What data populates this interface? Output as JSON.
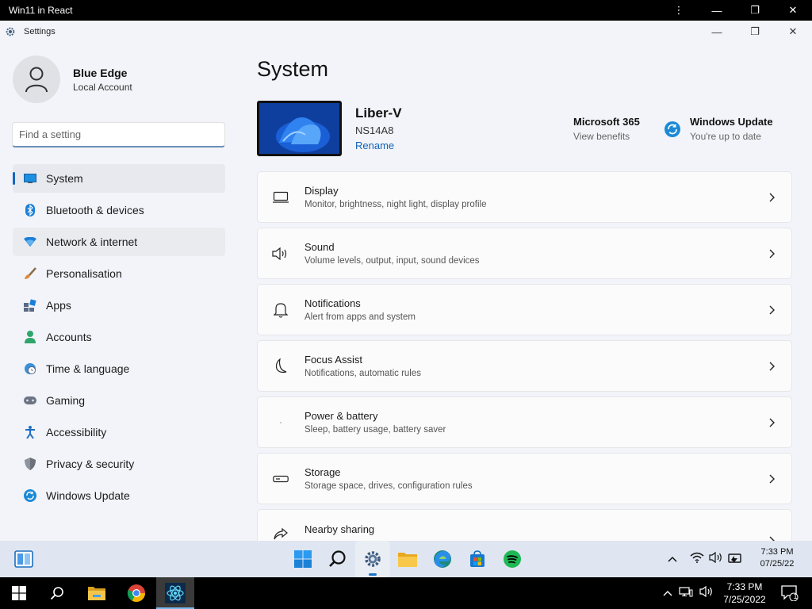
{
  "host": {
    "title": "Win11 in React",
    "controls": [
      "⋮",
      "—",
      "❐",
      "✕"
    ]
  },
  "settings_window": {
    "title": "Settings",
    "controls": [
      "—",
      "❐",
      "✕"
    ]
  },
  "profile": {
    "name": "Blue Edge",
    "account_type": "Local Account"
  },
  "search": {
    "placeholder": "Find a setting"
  },
  "sidebar": {
    "items": [
      {
        "label": "System",
        "icon": "monitor-icon",
        "state": "active"
      },
      {
        "label": "Bluetooth & devices",
        "icon": "bluetooth-icon"
      },
      {
        "label": "Network & internet",
        "icon": "wifi-icon",
        "state": "hover"
      },
      {
        "label": "Personalisation",
        "icon": "brush-icon"
      },
      {
        "label": "Apps",
        "icon": "apps-icon"
      },
      {
        "label": "Accounts",
        "icon": "person-icon"
      },
      {
        "label": "Time & language",
        "icon": "globe-clock-icon"
      },
      {
        "label": "Gaming",
        "icon": "gamepad-icon"
      },
      {
        "label": "Accessibility",
        "icon": "accessibility-icon"
      },
      {
        "label": "Privacy & security",
        "icon": "shield-icon"
      },
      {
        "label": "Windows Update",
        "icon": "update-icon"
      }
    ]
  },
  "main": {
    "title": "System",
    "device": {
      "name": "Liber-V",
      "model": "NS14A8",
      "rename_label": "Rename"
    },
    "quick": [
      {
        "title": "Microsoft 365",
        "subtitle": "View benefits"
      },
      {
        "title": "Windows Update",
        "subtitle": "You're up to date",
        "icon": "update-icon"
      }
    ],
    "cards": [
      {
        "title": "Display",
        "subtitle": "Monitor, brightness, night light, display profile",
        "icon": "display-icon"
      },
      {
        "title": "Sound",
        "subtitle": "Volume levels, output, input, sound devices",
        "icon": "speaker-icon"
      },
      {
        "title": "Notifications",
        "subtitle": "Alert from apps and system",
        "icon": "bell-icon"
      },
      {
        "title": "Focus Assist",
        "subtitle": "Notifications, automatic rules",
        "icon": "moon-icon"
      },
      {
        "title": "Power & battery",
        "subtitle": "Sleep, battery usage, battery saver",
        "icon": "power-icon"
      },
      {
        "title": "Storage",
        "subtitle": "Storage space, drives, configuration rules",
        "icon": "storage-icon"
      },
      {
        "title": "Nearby sharing",
        "subtitle": "",
        "icon": "share-icon"
      }
    ]
  },
  "taskbar11": {
    "apps": [
      "start-icon",
      "search-icon",
      "settings-icon",
      "explorer-icon",
      "edge-icon",
      "store-icon",
      "spotify-icon"
    ],
    "active_app": "settings-icon",
    "time": "7:33 PM",
    "date": "07/25/22"
  },
  "taskbar10": {
    "time": "7:33 PM",
    "date": "7/25/2022",
    "notification_count": "1"
  },
  "colors": {
    "accent": "#1565c0",
    "link": "#0f63b6",
    "window_bg": "#f2f4f9",
    "card_bg": "#fbfbfc"
  }
}
